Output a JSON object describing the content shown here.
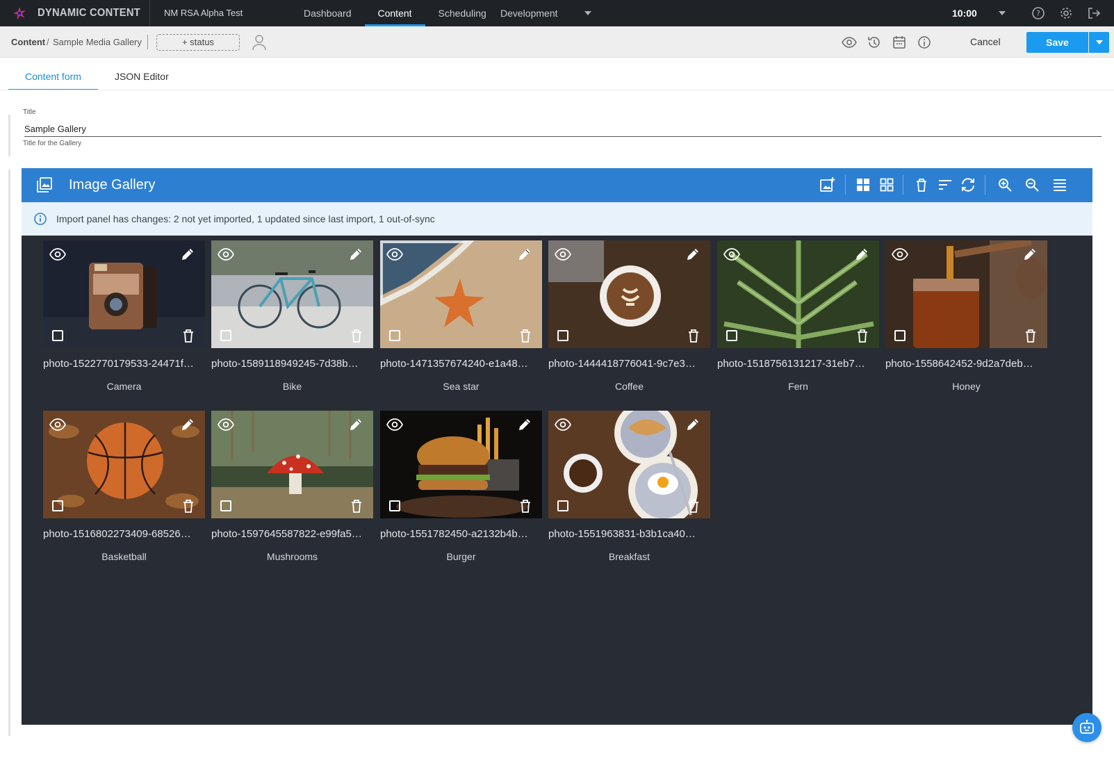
{
  "app": {
    "brand": "DYNAMIC CONTENT",
    "hub": "NM RSA Alpha Test",
    "nav": [
      {
        "label": "Dashboard",
        "active": false
      },
      {
        "label": "Content",
        "active": true
      },
      {
        "label": "Scheduling",
        "active": false
      }
    ],
    "nav_dropdown": "Development",
    "time": "10:00"
  },
  "breadcrumb": {
    "root": "Content",
    "separator": "/",
    "current": "Sample Media Gallery",
    "status_button": "+ status",
    "cancel": "Cancel",
    "save": "Save"
  },
  "tabs": [
    {
      "label": "Content form",
      "active": true
    },
    {
      "label": "JSON Editor",
      "active": false
    }
  ],
  "form": {
    "title_label": "Title",
    "title_value": "Sample Gallery",
    "title_help": "Title for the Gallery"
  },
  "gallery": {
    "title": "Image Gallery",
    "notice": "Import panel has changes: 2 not yet imported, 1 updated since last import, 1 out-of-sync",
    "items": [
      {
        "file": "photo-1522770179533-24471f…",
        "caption": "Camera"
      },
      {
        "file": "photo-1589118949245-7d38b…",
        "caption": "Bike"
      },
      {
        "file": "photo-1471357674240-e1a48…",
        "caption": "Sea star"
      },
      {
        "file": "photo-1444418776041-9c7e3…",
        "caption": "Coffee"
      },
      {
        "file": "photo-1518756131217-31eb7…",
        "caption": "Fern"
      },
      {
        "file": "photo-1558642452-9d2a7deb…",
        "caption": "Honey"
      },
      {
        "file": "photo-1516802273409-68526…",
        "caption": "Basketball"
      },
      {
        "file": "photo-1597645587822-e99fa5…",
        "caption": "Mushrooms"
      },
      {
        "file": "photo-1551782450-a2132b4b…",
        "caption": "Burger"
      },
      {
        "file": "photo-1551963831-b3b1ca40…",
        "caption": "Breakfast"
      }
    ]
  },
  "colors": {
    "accent": "#1a9bef",
    "gallery_header": "#2d7fd2",
    "gallery_bg": "#282c34",
    "topbar": "#1f2328"
  }
}
